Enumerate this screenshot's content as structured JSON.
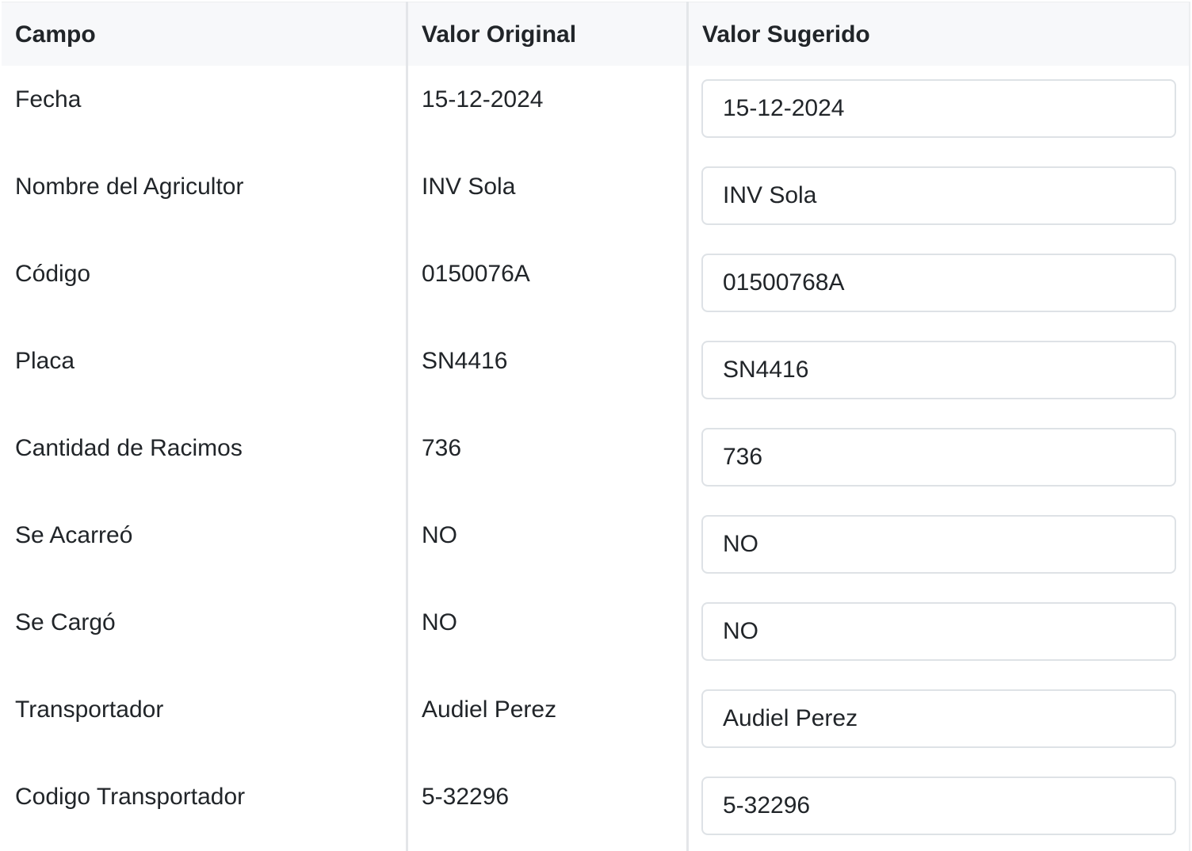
{
  "columns": {
    "field": "Campo",
    "original": "Valor Original",
    "suggested": "Valor Sugerido"
  },
  "rows": [
    {
      "field": "Fecha",
      "original": "15-12-2024",
      "suggested": "15-12-2024"
    },
    {
      "field": "Nombre del Agricultor",
      "original": "INV Sola",
      "suggested": "INV Sola"
    },
    {
      "field": "Código",
      "original": "0150076A",
      "suggested": "01500768A"
    },
    {
      "field": "Placa",
      "original": "SN4416",
      "suggested": "SN4416"
    },
    {
      "field": "Cantidad de Racimos",
      "original": "736",
      "suggested": "736"
    },
    {
      "field": "Se Acarreó",
      "original": "NO",
      "suggested": "NO"
    },
    {
      "field": "Se Cargó",
      "original": "NO",
      "suggested": "NO"
    },
    {
      "field": "Transportador",
      "original": "Audiel Perez",
      "suggested": "Audiel Perez"
    },
    {
      "field": "Codigo Transportador",
      "original": "5-32296",
      "suggested": "5-32296"
    }
  ]
}
